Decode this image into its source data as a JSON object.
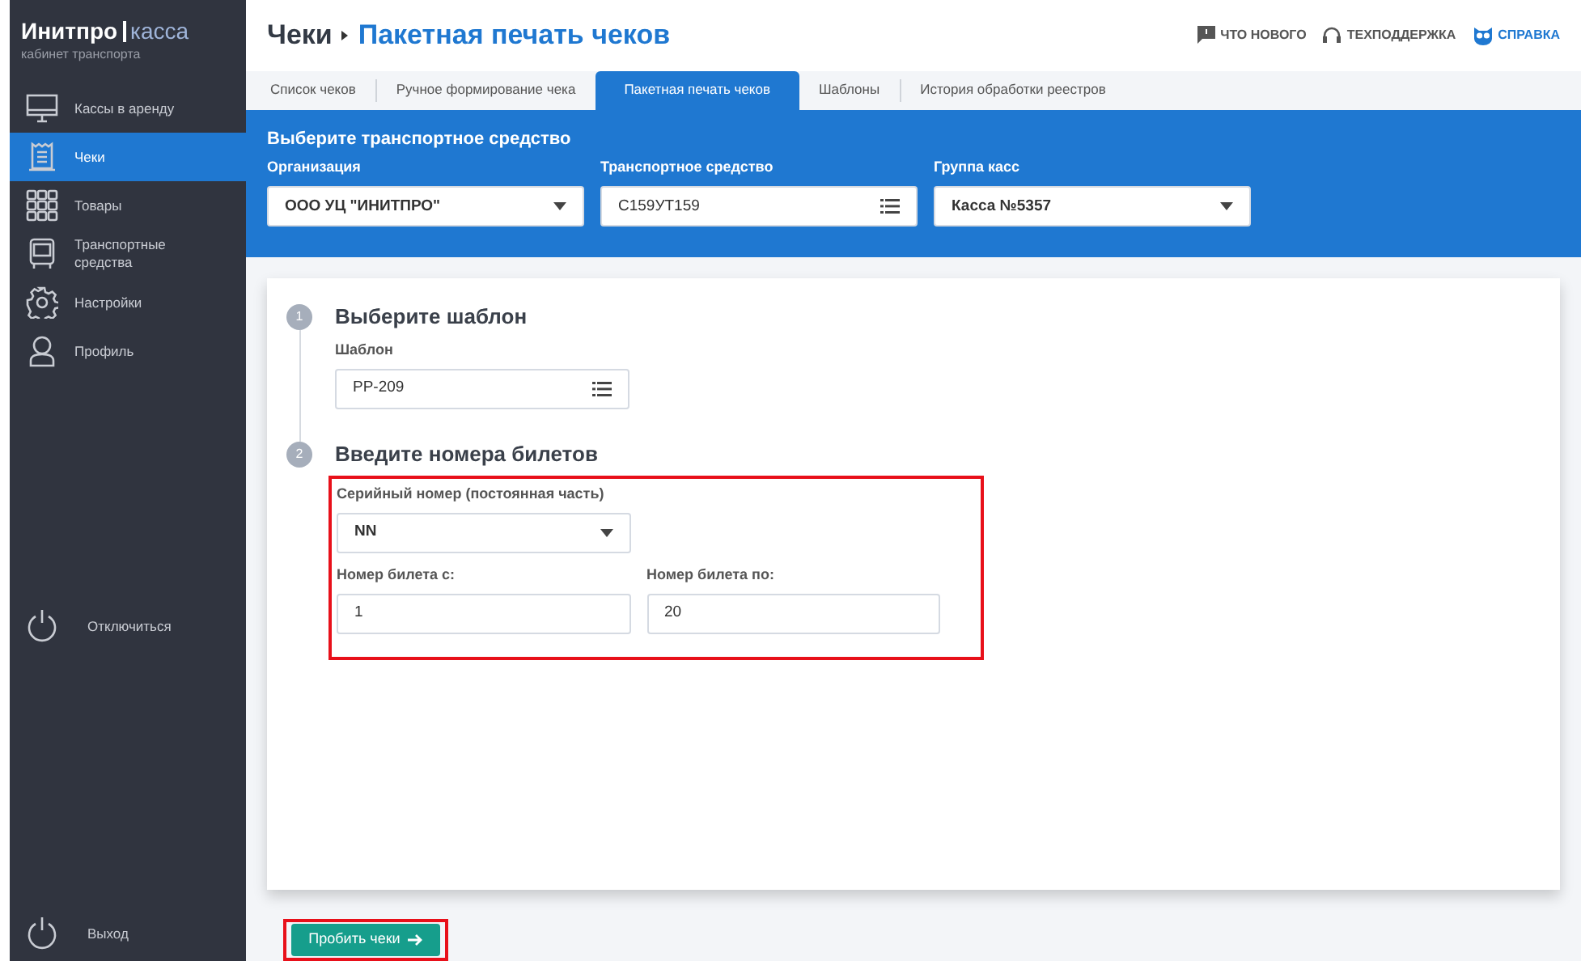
{
  "brand": {
    "name": "Инитпро",
    "product": "касса",
    "subtitle": "кабинет транспорта"
  },
  "sidebar": {
    "items": [
      {
        "label": "Кассы в аренду",
        "selected": false
      },
      {
        "label": "Чеки",
        "selected": true
      },
      {
        "label": "Товары",
        "selected": false
      },
      {
        "label": "Транспортные средства",
        "selected": false
      },
      {
        "label": "Настройки",
        "selected": false
      },
      {
        "label": "Профиль",
        "selected": false
      }
    ],
    "disconnect": "Отключиться",
    "logout": "Выход"
  },
  "breadcrumb": {
    "parent": "Чеки",
    "current": "Пакетная печать чеков"
  },
  "header_links": [
    "ЧТО НОВОГО",
    "ТЕХПОДДЕРЖКА",
    "СПРАВКА"
  ],
  "tabs": [
    {
      "label": "Список чеков",
      "selected": false
    },
    {
      "label": "Ручное формирование чека",
      "selected": false
    },
    {
      "label": "Пакетная печать чеков",
      "selected": true
    },
    {
      "label": "Шаблоны",
      "selected": false
    },
    {
      "label": "История обработки реестров",
      "selected": false
    }
  ],
  "vehicle_panel": {
    "title": "Выберите транспортное средство",
    "fields": [
      {
        "label": "Организация",
        "value": "ООО УЦ \"ИНИТПРО\"",
        "kind": "dropdown"
      },
      {
        "label": "Транспортное средство",
        "value": "С159УТ159",
        "kind": "list"
      },
      {
        "label": "Группа касс",
        "value": "Касса №5357",
        "kind": "dropdown"
      }
    ]
  },
  "steps": [
    {
      "number": "1",
      "title": "Выберите шаблон",
      "fields": [
        {
          "label": "Шаблон",
          "value": "PP-209",
          "kind": "list"
        }
      ]
    },
    {
      "number": "2",
      "title": "Введите номера билетов",
      "fields": [
        {
          "label": "Серийный номер (постоянная часть)",
          "value": "NN",
          "kind": "dropdown"
        },
        {
          "label": "Номер билета с:",
          "value": "1",
          "kind": "text"
        },
        {
          "label": "Номер билета по:",
          "value": "20",
          "kind": "text"
        }
      ]
    }
  ],
  "submit_button": "Пробить чеки"
}
